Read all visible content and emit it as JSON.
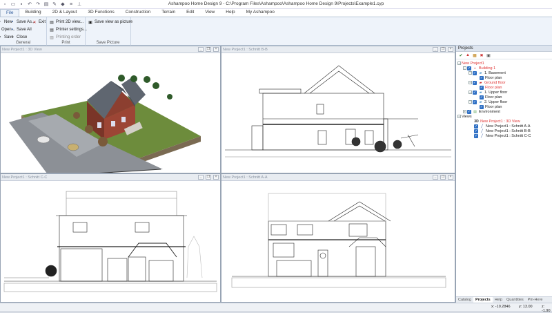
{
  "window": {
    "title": "Ashampoo Home Design 9 - C:\\Program Files\\Ashampoo\\Ashampoo Home Design 9\\Projects\\Example1.cyp"
  },
  "quick_access": [
    "new-icon",
    "open-icon",
    "save-icon",
    "undo-icon",
    "redo-icon",
    "print-icon",
    "brush-icon",
    "eraser-icon",
    "layers-icon",
    "pin-icon"
  ],
  "tabs": [
    "File",
    "Building",
    "2D & Layout",
    "3D Functions",
    "Construction",
    "Terrain",
    "Edit",
    "View",
    "Help",
    "My Ashampoo"
  ],
  "ribbon": {
    "general": {
      "label": "General",
      "buttons": [
        "New",
        "Open...",
        "Save",
        "Save As...",
        "Save All",
        "Close",
        "Exit"
      ]
    },
    "print": {
      "label": "Print",
      "buttons": [
        "Print 2D view...",
        "Printer settings...",
        "Printing order"
      ]
    },
    "save_picture": {
      "label": "Save Picture",
      "buttons": [
        "Save view as picture"
      ]
    }
  },
  "viewports": [
    {
      "title": "New Project1 : 3D View"
    },
    {
      "title": "New Project1 : Schnitt B-B"
    },
    {
      "title": "New Project1 : Schnitt C-C"
    },
    {
      "title": "New Project1 : Schnitt A-A"
    }
  ],
  "projects": {
    "header": "Projects",
    "tree": [
      {
        "label": "New Project1",
        "red": true
      },
      {
        "label": "Building 1",
        "red": true
      },
      {
        "label": "1. Basement"
      },
      {
        "label": "Floor plan"
      },
      {
        "label": "Ground floor",
        "red": true
      },
      {
        "label": "Floor plan",
        "red": true
      },
      {
        "label": "1. Upper floor"
      },
      {
        "label": "Floor plan"
      },
      {
        "label": "2. Upper floor"
      },
      {
        "label": "Floor plan"
      },
      {
        "label": "Environment"
      },
      {
        "label": "Views"
      },
      {
        "label": "New Project1 : 3D View",
        "red": true
      },
      {
        "label": "New Project1 : Schnitt A-A"
      },
      {
        "label": "New Project1 : Schnitt B-B"
      },
      {
        "label": "New Project1 : Schnitt C-C"
      }
    ],
    "bottom_tabs": [
      "Catalog",
      "Projects",
      "Help",
      "Quantities",
      "Pin-Here"
    ]
  },
  "status": {
    "x": "x: -10.2846",
    "y": "y: 13.00",
    "z": "z: -1.90"
  },
  "colors": {
    "accent": "#2b579a",
    "red": "#e03434",
    "grass": "#6d8c3c",
    "roof": "#5f6670"
  }
}
